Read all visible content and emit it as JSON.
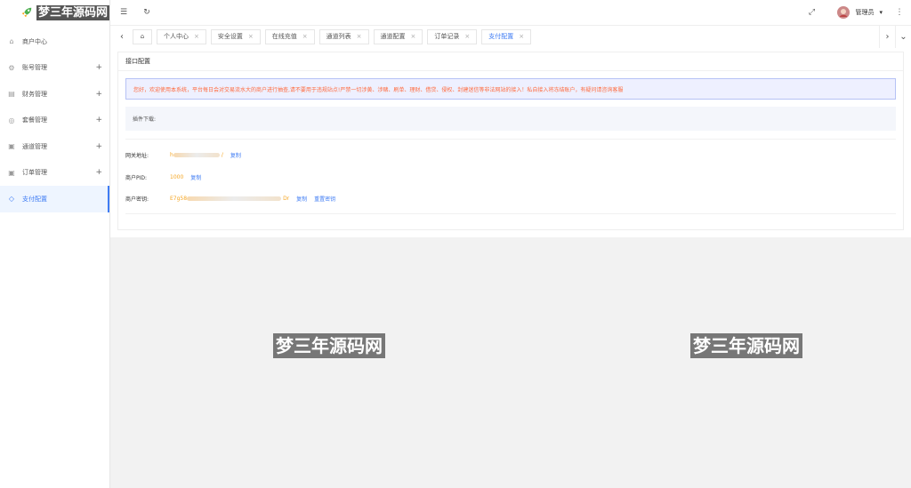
{
  "app": {
    "logo_text": "梦三年源码网"
  },
  "sidebar": {
    "items": [
      {
        "label": "商户中心",
        "icon": "home-icon",
        "expandable": false,
        "active": false
      },
      {
        "label": "账号管理",
        "icon": "gear-icon",
        "expandable": true,
        "active": false
      },
      {
        "label": "财务管理",
        "icon": "wallet-icon",
        "expandable": true,
        "active": false
      },
      {
        "label": "套餐管理",
        "icon": "package-icon",
        "expandable": true,
        "active": false
      },
      {
        "label": "通道管理",
        "icon": "channel-icon",
        "expandable": true,
        "active": false
      },
      {
        "label": "订单管理",
        "icon": "order-icon",
        "expandable": true,
        "active": false
      },
      {
        "label": "支付配置",
        "icon": "settings-icon",
        "expandable": false,
        "active": true
      }
    ],
    "plus": "+"
  },
  "topbar": {
    "user_name": "管理员",
    "caret": "▾"
  },
  "tabs": [
    {
      "label": "个人中心",
      "active": false
    },
    {
      "label": "安全设置",
      "active": false
    },
    {
      "label": "在线充值",
      "active": false
    },
    {
      "label": "通道列表",
      "active": false
    },
    {
      "label": "通道配置",
      "active": false
    },
    {
      "label": "订单记录",
      "active": false
    },
    {
      "label": "支付配置",
      "active": true
    }
  ],
  "tab_close": "×",
  "card": {
    "title": "接口配置",
    "notice": "您好，欢迎使用本系统，平台每日会对交易流水大的商户进行抽查,请不要用于违规站点!严禁一切涉黄、涉赌、刷单、理财、借贷、侵权、封建迷信等非法网站的接入！私自接入将冻结账户，有疑问请咨询客服",
    "plugin_label": "插件下载:",
    "fields": [
      {
        "label": "网关地址:",
        "value": "h",
        "value_suffix": "/",
        "links": [
          "复制"
        ]
      },
      {
        "label": "商户PID:",
        "value": "1000",
        "value_suffix": "",
        "links": [
          "复制"
        ]
      },
      {
        "label": "商户密钥:",
        "value": "E7g58",
        "value_suffix": "Dr",
        "links": [
          "复制",
          "重置密钥"
        ]
      }
    ]
  },
  "watermarks": [
    "梦三年源码网",
    "梦三年源码网"
  ],
  "colors": {
    "accent": "#3f7cf4",
    "notice_text": "#ff6a3d",
    "value_text": "#f5a623"
  }
}
